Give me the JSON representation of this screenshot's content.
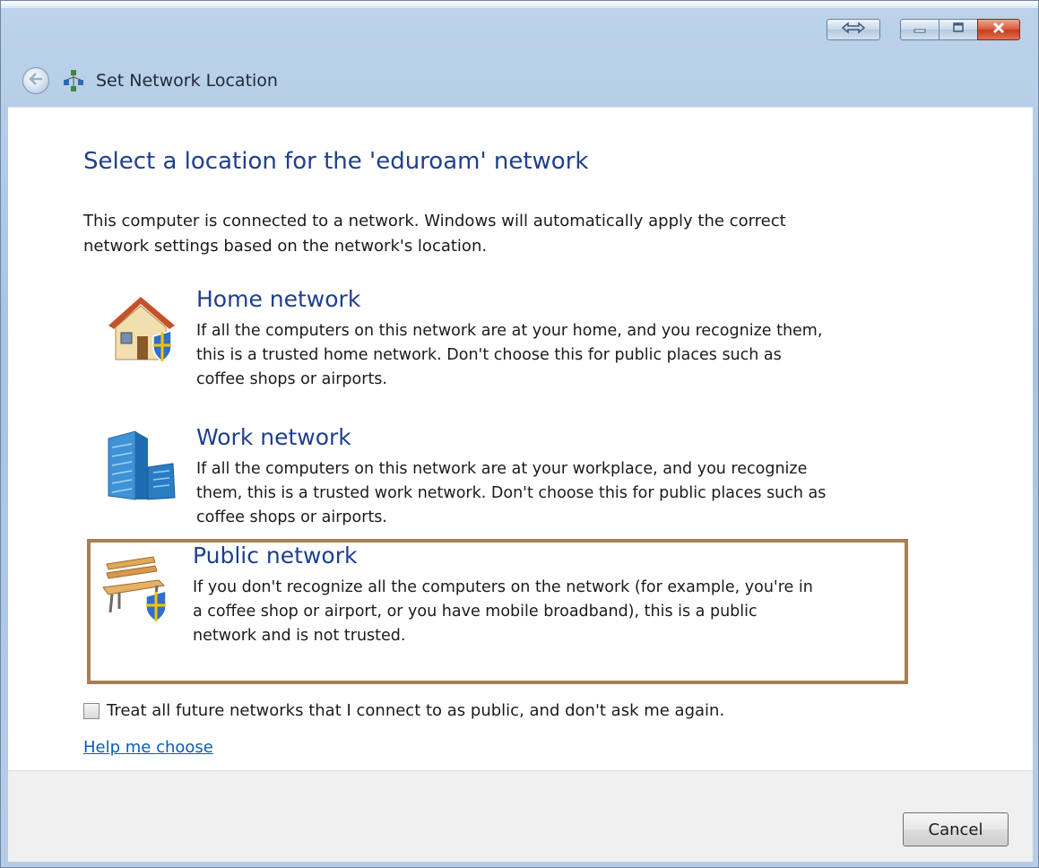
{
  "window": {
    "title": "Set Network Location",
    "caption_buttons": [
      "snap-icon",
      "minimize-icon",
      "maximize-icon",
      "close-icon"
    ]
  },
  "main": {
    "heading": "Select a location for the 'eduroam' network",
    "intro_line1": "This computer is connected to a network. Windows will automatically apply the correct",
    "intro_line2": "network settings based on the network's location."
  },
  "options": [
    {
      "icon": "house-shield-icon",
      "title": "Home network",
      "line1": "If all the computers on this network are at your home, and you recognize them,",
      "line2": "this is a trusted home network.  Don't choose this for public places such as",
      "line3": "coffee shops or airports.",
      "selected": false
    },
    {
      "icon": "office-building-icon",
      "title": "Work network",
      "line1": "If all the computers on this network are at your workplace, and you recognize",
      "line2": "them, this is a trusted work network.  Don't choose this for public places such as",
      "line3": "coffee shops or airports.",
      "selected": false
    },
    {
      "icon": "park-bench-shield-icon",
      "title": "Public network",
      "line1": "If you don't recognize all the computers on the network (for example, you're in",
      "line2": "a coffee shop or airport, or you have mobile broadband), this is a public",
      "line3": "network and is not trusted.",
      "selected": true
    }
  ],
  "checkbox": {
    "label": "Treat all future networks that I connect to as public, and don't ask me again.",
    "checked": false
  },
  "help_link": "Help me choose",
  "footer": {
    "cancel_label": "Cancel"
  },
  "colors": {
    "heading": "#1f3f8f",
    "link": "#0b5cb8",
    "selection_border": "#a97d55",
    "close_button": "#c43c1d"
  }
}
